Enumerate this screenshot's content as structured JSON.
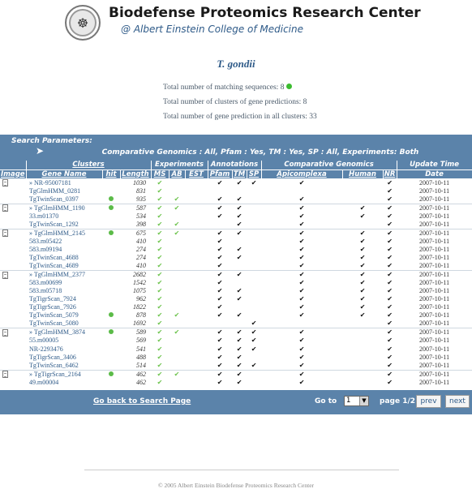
{
  "header": {
    "title": "Biodefense Proteomics Research Center",
    "subtitle": "@ Albert Einstein College of Medicine"
  },
  "species": "T. gondii",
  "stats": {
    "matching_label": "Total number of matching sequences: 8",
    "clusters_label": "Total number of clusters of gene predictions: 8",
    "predictions_label": "Total number of gene prediction in all clusters: 33"
  },
  "search_params": {
    "label": "Search Parameters:",
    "line": "Comparative Genomics : All,  Pfam : Yes,  TM : Yes,  SP : All,  Experiments: Both"
  },
  "table": {
    "group_headers": {
      "clusters": "Clusters",
      "experiments": "Experiments",
      "annotations": "Annotations",
      "comparative": "Comparative Genomics",
      "update": "Update Time"
    },
    "columns": {
      "image": "Image",
      "gene": "Gene Name",
      "hit": "hit",
      "length": "Length",
      "ms": "MS",
      "ab": "AB",
      "est": "EST",
      "pfam": "Pfam",
      "tm": "TM",
      "sp": "SP",
      "apicomplexa": "Apicomplexa",
      "human": "Human",
      "nr": "NR",
      "date": "Date"
    },
    "rows": [
      {
        "first": true,
        "name": "» NR-95007181",
        "hit": false,
        "length": "1030",
        "ms": true,
        "ab": false,
        "est": false,
        "pfam": true,
        "tm": true,
        "sp": true,
        "apico": true,
        "human": false,
        "nr": true,
        "date": "2007-10-11"
      },
      {
        "first": false,
        "name": "TgGlmHMM_0281",
        "hit": false,
        "length": "831",
        "ms": true,
        "ab": false,
        "est": false,
        "pfam": false,
        "tm": false,
        "sp": false,
        "apico": false,
        "human": false,
        "nr": true,
        "date": "2007-10-11"
      },
      {
        "first": false,
        "name": "TgTwinScan_0397",
        "hit": true,
        "length": "935",
        "ms": true,
        "ab": true,
        "est": false,
        "pfam": true,
        "tm": true,
        "sp": false,
        "apico": true,
        "human": false,
        "nr": true,
        "date": "2007-10-11"
      },
      {
        "first": true,
        "name": "» TgGlmHMM_1190",
        "hit": true,
        "length": "587",
        "ms": true,
        "ab": true,
        "est": false,
        "pfam": true,
        "tm": true,
        "sp": false,
        "apico": true,
        "human": true,
        "nr": true,
        "date": "2007-10-11"
      },
      {
        "first": false,
        "name": "33.m01370",
        "hit": false,
        "length": "534",
        "ms": true,
        "ab": false,
        "est": false,
        "pfam": true,
        "tm": true,
        "sp": false,
        "apico": true,
        "human": true,
        "nr": true,
        "date": "2007-10-11"
      },
      {
        "first": false,
        "name": "TgTwinScan_1292",
        "hit": false,
        "length": "398",
        "ms": true,
        "ab": true,
        "est": false,
        "pfam": false,
        "tm": true,
        "sp": false,
        "apico": true,
        "human": false,
        "nr": true,
        "date": "2007-10-11"
      },
      {
        "first": true,
        "name": "» TgGlmHMM_2145",
        "hit": true,
        "length": "675",
        "ms": true,
        "ab": true,
        "est": false,
        "pfam": true,
        "tm": true,
        "sp": false,
        "apico": true,
        "human": true,
        "nr": true,
        "date": "2007-10-11"
      },
      {
        "first": false,
        "name": "583.m05422",
        "hit": false,
        "length": "410",
        "ms": true,
        "ab": false,
        "est": false,
        "pfam": true,
        "tm": false,
        "sp": false,
        "apico": true,
        "human": true,
        "nr": true,
        "date": "2007-10-11"
      },
      {
        "first": false,
        "name": "583.m09194",
        "hit": false,
        "length": "274",
        "ms": true,
        "ab": false,
        "est": false,
        "pfam": true,
        "tm": true,
        "sp": false,
        "apico": true,
        "human": true,
        "nr": true,
        "date": "2007-10-11"
      },
      {
        "first": false,
        "name": "TgTwinScan_4688",
        "hit": false,
        "length": "274",
        "ms": true,
        "ab": false,
        "est": false,
        "pfam": true,
        "tm": true,
        "sp": false,
        "apico": true,
        "human": true,
        "nr": true,
        "date": "2007-10-11"
      },
      {
        "first": false,
        "name": "TgTwinScan_4689",
        "hit": false,
        "length": "410",
        "ms": true,
        "ab": false,
        "est": false,
        "pfam": true,
        "tm": false,
        "sp": false,
        "apico": true,
        "human": true,
        "nr": true,
        "date": "2007-10-11"
      },
      {
        "first": true,
        "name": "» TgGlmHMM_2377",
        "hit": false,
        "length": "2682",
        "ms": true,
        "ab": false,
        "est": false,
        "pfam": true,
        "tm": true,
        "sp": false,
        "apico": true,
        "human": true,
        "nr": true,
        "date": "2007-10-11"
      },
      {
        "first": false,
        "name": "583.m00699",
        "hit": false,
        "length": "1542",
        "ms": true,
        "ab": false,
        "est": false,
        "pfam": true,
        "tm": false,
        "sp": false,
        "apico": true,
        "human": true,
        "nr": true,
        "date": "2007-10-11"
      },
      {
        "first": false,
        "name": "583.m05718",
        "hit": false,
        "length": "1075",
        "ms": true,
        "ab": false,
        "est": false,
        "pfam": true,
        "tm": true,
        "sp": false,
        "apico": true,
        "human": true,
        "nr": true,
        "date": "2007-10-11"
      },
      {
        "first": false,
        "name": "TgTigrScan_7924",
        "hit": false,
        "length": "962",
        "ms": true,
        "ab": false,
        "est": false,
        "pfam": true,
        "tm": true,
        "sp": false,
        "apico": true,
        "human": true,
        "nr": true,
        "date": "2007-10-11"
      },
      {
        "first": false,
        "name": "TgTigrScan_7926",
        "hit": false,
        "length": "1822",
        "ms": true,
        "ab": false,
        "est": false,
        "pfam": true,
        "tm": false,
        "sp": false,
        "apico": true,
        "human": true,
        "nr": true,
        "date": "2007-10-11"
      },
      {
        "first": false,
        "name": "TgTwinScan_5079",
        "hit": true,
        "length": "878",
        "ms": true,
        "ab": true,
        "est": false,
        "pfam": true,
        "tm": true,
        "sp": false,
        "apico": true,
        "human": true,
        "nr": true,
        "date": "2007-10-11"
      },
      {
        "first": false,
        "name": "TgTwinScan_5080",
        "hit": false,
        "length": "1692",
        "ms": true,
        "ab": false,
        "est": false,
        "pfam": false,
        "tm": false,
        "sp": true,
        "apico": false,
        "human": false,
        "nr": true,
        "date": "2007-10-11"
      },
      {
        "first": true,
        "name": "» TgGlmHMM_3874",
        "hit": true,
        "length": "589",
        "ms": true,
        "ab": true,
        "est": false,
        "pfam": true,
        "tm": true,
        "sp": true,
        "apico": true,
        "human": false,
        "nr": true,
        "date": "2007-10-11"
      },
      {
        "first": false,
        "name": "55.m00005",
        "hit": false,
        "length": "569",
        "ms": true,
        "ab": false,
        "est": false,
        "pfam": true,
        "tm": true,
        "sp": true,
        "apico": true,
        "human": false,
        "nr": true,
        "date": "2007-10-11"
      },
      {
        "first": false,
        "name": "NR-2293476",
        "hit": false,
        "length": "541",
        "ms": true,
        "ab": false,
        "est": false,
        "pfam": true,
        "tm": true,
        "sp": true,
        "apico": true,
        "human": false,
        "nr": true,
        "date": "2007-10-11"
      },
      {
        "first": false,
        "name": "TgTigrScan_3406",
        "hit": false,
        "length": "488",
        "ms": true,
        "ab": false,
        "est": false,
        "pfam": true,
        "tm": true,
        "sp": false,
        "apico": true,
        "human": false,
        "nr": true,
        "date": "2007-10-11"
      },
      {
        "first": false,
        "name": "TgTwinScan_6462",
        "hit": false,
        "length": "514",
        "ms": true,
        "ab": false,
        "est": false,
        "pfam": true,
        "tm": true,
        "sp": true,
        "apico": true,
        "human": false,
        "nr": true,
        "date": "2007-10-11"
      },
      {
        "first": true,
        "name": "» TgTigrScan_2164",
        "hit": true,
        "length": "462",
        "ms": true,
        "ab": true,
        "est": false,
        "pfam": true,
        "tm": true,
        "sp": false,
        "apico": true,
        "human": false,
        "nr": true,
        "date": "2007-10-11"
      },
      {
        "first": false,
        "name": "49.m00004",
        "hit": false,
        "length": "462",
        "ms": true,
        "ab": false,
        "est": false,
        "pfam": true,
        "tm": true,
        "sp": false,
        "apico": true,
        "human": false,
        "nr": true,
        "date": "2007-10-11"
      }
    ]
  },
  "footer": {
    "back_link": "Go back to Search Page",
    "goto_label": "Go to",
    "page_select_value": "1",
    "page_info": "page 1/2",
    "prev_label": "prev",
    "next_label": "next"
  },
  "copyright": "© 2005 Albert Einstein Biodefense Proteomics Research Center",
  "icons": {
    "seal": "college-seal-icon",
    "row_image": "document-icon",
    "hit": "green-dot-icon",
    "check_black": "black-check-icon",
    "check_green": "green-check-icon",
    "select_arrow": "dropdown-arrow-icon"
  },
  "colors": {
    "header_blue": "#5b83aa",
    "link_blue": "#2e5a88",
    "hit_green": "#5bbb48"
  }
}
